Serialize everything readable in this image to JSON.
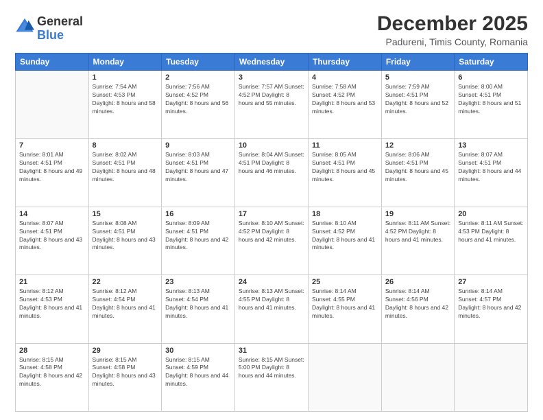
{
  "logo": {
    "general": "General",
    "blue": "Blue"
  },
  "title": "December 2025",
  "subtitle": "Padureni, Timis County, Romania",
  "weekdays": [
    "Sunday",
    "Monday",
    "Tuesday",
    "Wednesday",
    "Thursday",
    "Friday",
    "Saturday"
  ],
  "weeks": [
    [
      {
        "day": "",
        "info": ""
      },
      {
        "day": "1",
        "info": "Sunrise: 7:54 AM\nSunset: 4:53 PM\nDaylight: 8 hours\nand 58 minutes."
      },
      {
        "day": "2",
        "info": "Sunrise: 7:56 AM\nSunset: 4:52 PM\nDaylight: 8 hours\nand 56 minutes."
      },
      {
        "day": "3",
        "info": "Sunrise: 7:57 AM\nSunset: 4:52 PM\nDaylight: 8 hours\nand 55 minutes."
      },
      {
        "day": "4",
        "info": "Sunrise: 7:58 AM\nSunset: 4:52 PM\nDaylight: 8 hours\nand 53 minutes."
      },
      {
        "day": "5",
        "info": "Sunrise: 7:59 AM\nSunset: 4:51 PM\nDaylight: 8 hours\nand 52 minutes."
      },
      {
        "day": "6",
        "info": "Sunrise: 8:00 AM\nSunset: 4:51 PM\nDaylight: 8 hours\nand 51 minutes."
      }
    ],
    [
      {
        "day": "7",
        "info": "Sunrise: 8:01 AM\nSunset: 4:51 PM\nDaylight: 8 hours\nand 49 minutes."
      },
      {
        "day": "8",
        "info": "Sunrise: 8:02 AM\nSunset: 4:51 PM\nDaylight: 8 hours\nand 48 minutes."
      },
      {
        "day": "9",
        "info": "Sunrise: 8:03 AM\nSunset: 4:51 PM\nDaylight: 8 hours\nand 47 minutes."
      },
      {
        "day": "10",
        "info": "Sunrise: 8:04 AM\nSunset: 4:51 PM\nDaylight: 8 hours\nand 46 minutes."
      },
      {
        "day": "11",
        "info": "Sunrise: 8:05 AM\nSunset: 4:51 PM\nDaylight: 8 hours\nand 45 minutes."
      },
      {
        "day": "12",
        "info": "Sunrise: 8:06 AM\nSunset: 4:51 PM\nDaylight: 8 hours\nand 45 minutes."
      },
      {
        "day": "13",
        "info": "Sunrise: 8:07 AM\nSunset: 4:51 PM\nDaylight: 8 hours\nand 44 minutes."
      }
    ],
    [
      {
        "day": "14",
        "info": "Sunrise: 8:07 AM\nSunset: 4:51 PM\nDaylight: 8 hours\nand 43 minutes."
      },
      {
        "day": "15",
        "info": "Sunrise: 8:08 AM\nSunset: 4:51 PM\nDaylight: 8 hours\nand 43 minutes."
      },
      {
        "day": "16",
        "info": "Sunrise: 8:09 AM\nSunset: 4:51 PM\nDaylight: 8 hours\nand 42 minutes."
      },
      {
        "day": "17",
        "info": "Sunrise: 8:10 AM\nSunset: 4:52 PM\nDaylight: 8 hours\nand 42 minutes."
      },
      {
        "day": "18",
        "info": "Sunrise: 8:10 AM\nSunset: 4:52 PM\nDaylight: 8 hours\nand 41 minutes."
      },
      {
        "day": "19",
        "info": "Sunrise: 8:11 AM\nSunset: 4:52 PM\nDaylight: 8 hours\nand 41 minutes."
      },
      {
        "day": "20",
        "info": "Sunrise: 8:11 AM\nSunset: 4:53 PM\nDaylight: 8 hours\nand 41 minutes."
      }
    ],
    [
      {
        "day": "21",
        "info": "Sunrise: 8:12 AM\nSunset: 4:53 PM\nDaylight: 8 hours\nand 41 minutes."
      },
      {
        "day": "22",
        "info": "Sunrise: 8:12 AM\nSunset: 4:54 PM\nDaylight: 8 hours\nand 41 minutes."
      },
      {
        "day": "23",
        "info": "Sunrise: 8:13 AM\nSunset: 4:54 PM\nDaylight: 8 hours\nand 41 minutes."
      },
      {
        "day": "24",
        "info": "Sunrise: 8:13 AM\nSunset: 4:55 PM\nDaylight: 8 hours\nand 41 minutes."
      },
      {
        "day": "25",
        "info": "Sunrise: 8:14 AM\nSunset: 4:55 PM\nDaylight: 8 hours\nand 41 minutes."
      },
      {
        "day": "26",
        "info": "Sunrise: 8:14 AM\nSunset: 4:56 PM\nDaylight: 8 hours\nand 42 minutes."
      },
      {
        "day": "27",
        "info": "Sunrise: 8:14 AM\nSunset: 4:57 PM\nDaylight: 8 hours\nand 42 minutes."
      }
    ],
    [
      {
        "day": "28",
        "info": "Sunrise: 8:15 AM\nSunset: 4:58 PM\nDaylight: 8 hours\nand 42 minutes."
      },
      {
        "day": "29",
        "info": "Sunrise: 8:15 AM\nSunset: 4:58 PM\nDaylight: 8 hours\nand 43 minutes."
      },
      {
        "day": "30",
        "info": "Sunrise: 8:15 AM\nSunset: 4:59 PM\nDaylight: 8 hours\nand 44 minutes."
      },
      {
        "day": "31",
        "info": "Sunrise: 8:15 AM\nSunset: 5:00 PM\nDaylight: 8 hours\nand 44 minutes."
      },
      {
        "day": "",
        "info": ""
      },
      {
        "day": "",
        "info": ""
      },
      {
        "day": "",
        "info": ""
      }
    ]
  ]
}
